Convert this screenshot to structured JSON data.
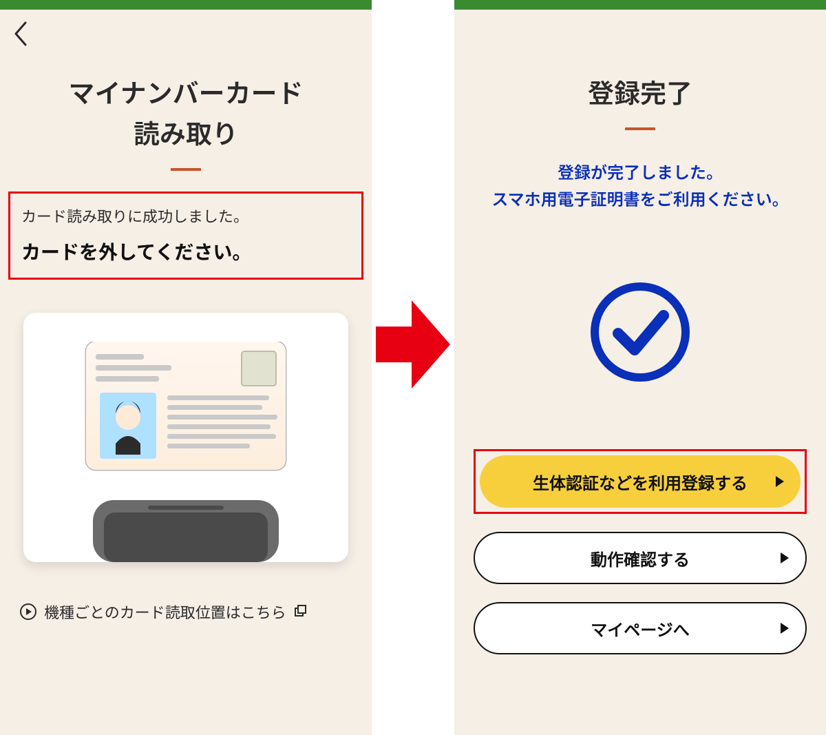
{
  "colors": {
    "green_bar": "#3a8a30",
    "accent_divider": "#c9552a",
    "highlight_border": "#e60012",
    "blue": "#0a2fb8",
    "yellow": "#f7cf3c"
  },
  "left": {
    "title_line1": "マイナンバーカード",
    "title_line2": "読み取り",
    "status": {
      "line1": "カード読み取りに成功しました。",
      "line2": "カードを外してください。"
    },
    "link": {
      "text": "機種ごとのカード読取位置はこちら",
      "external_icon": "⧉"
    }
  },
  "right": {
    "title": "登録完了",
    "info_line1": "登録が完了しました。",
    "info_line2": "スマホ用電子証明書をご利用ください。",
    "buttons": {
      "primary": "生体認証などを利用登録する",
      "check": "動作確認する",
      "mypage": "マイページへ"
    }
  }
}
